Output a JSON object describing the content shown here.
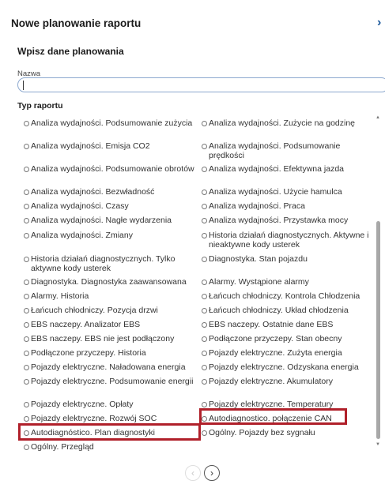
{
  "dialog": {
    "title": "Nowe planowanie raportu",
    "subtitle": "Wpisz dane planowania",
    "name_label": "Nazwa",
    "name_value": "",
    "report_type_label": "Typ raportu"
  },
  "report_types": [
    "Analiza wydajności. Podsumowanie zużycia",
    "Analiza wydajności. Zużycie na godzinę",
    "Analiza wydajności. Emisja CO2",
    "Analiza wydajności. Podsumowanie prędkości",
    "Analiza wydajności. Podsumowanie obrotów",
    "Analiza wydajności. Efektywna jazda",
    "Analiza wydajności. Bezwładność",
    "Analiza wydajności. Użycie hamulca",
    "Analiza wydajności. Czasy",
    "Analiza wydajności. Praca",
    "Analiza wydajności. Nagłe wydarzenia",
    "Analiza wydajności. Przystawka mocy",
    "Analiza wydajności. Zmiany",
    "Historia działań diagnostycznych. Aktywne i nieaktywne kody usterek",
    "Historia działań diagnostycznych. Tylko aktywne kody usterek",
    "Diagnostyka. Stan pojazdu",
    "Diagnostyka. Diagnostyka zaawansowana",
    "Alarmy. Wystąpione alarmy",
    "Alarmy. Historia",
    "Łańcuch chłodniczy. Kontrola Chłodzenia",
    "Łańcuch chłodniczy. Pozycja drzwi",
    "Łańcuch chłodniczy. Układ chłodzenia",
    "EBS naczepy. Analizator EBS",
    "EBS naczepy. Ostatnie dane EBS",
    "EBS naczepy. EBS nie jest podłączony",
    "Podłączone przyczepy. Stan obecny",
    "Podłączone przyczepy. Historia",
    "Pojazdy elektryczne. Zużyta energia",
    "Pojazdy elektryczne. Naładowana energia",
    "Pojazdy elektryczne. Odzyskana energia",
    "Pojazdy elektryczne. Podsumowanie energii",
    "Pojazdy elektryczne. Akumulatory",
    "Pojazdy elektryczne. Opłaty",
    "Pojazdy elektryczne. Temperatury",
    "Pojazdy elektryczne. Rozwój SOC",
    "Autodiagnostico. połączenie CAN",
    "Autodiagnóstico. Plan diagnostyki",
    "Ogólny. Pojazdy bez sygnału",
    "Ogólny. Przegląd"
  ],
  "highlight_color": "#b0202a",
  "icons": {
    "close": "chevron-right-icon",
    "prev": "chevron-left-icon",
    "next": "chevron-right-icon"
  },
  "pager": {
    "prev_glyph": "‹",
    "next_glyph": "›"
  },
  "close_glyph": "›"
}
